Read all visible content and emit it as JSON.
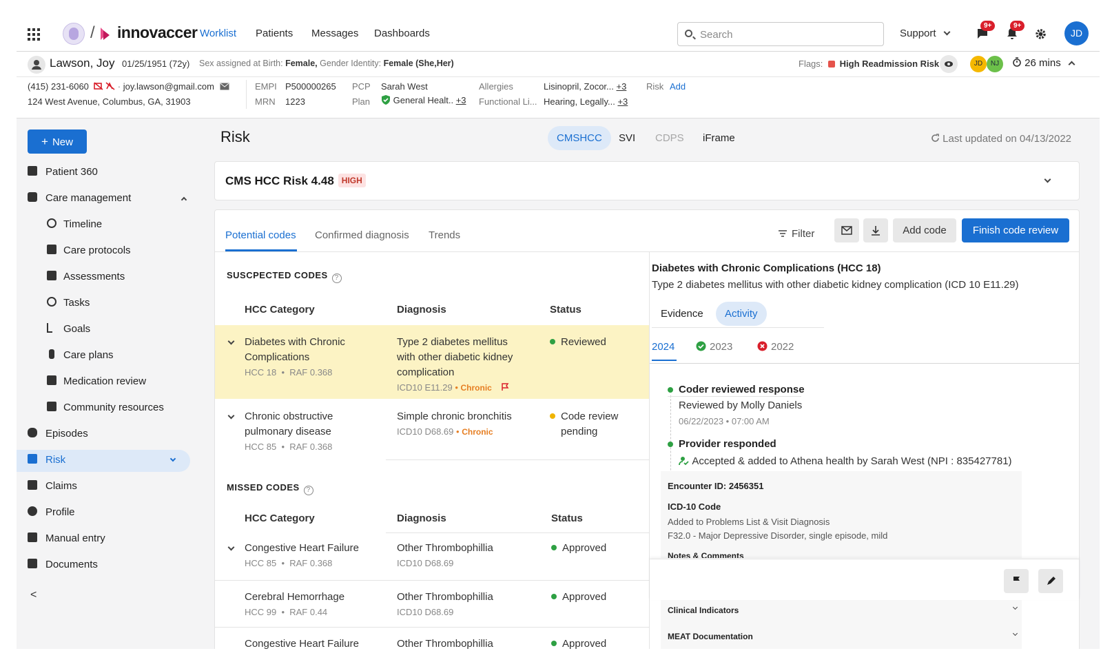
{
  "nav": {
    "brand": "innovaccer",
    "slash": "/",
    "links": [
      "Worklist",
      "Patients",
      "Messages",
      "Dashboards"
    ],
    "search_placeholder": "Search",
    "support": "Support",
    "chat_badge": "9+",
    "bell_badge": "9+",
    "avatar": "JD"
  },
  "patient": {
    "name": "Lawson, Joy",
    "dob": "01/25/1951 (72y)",
    "sex_label": "Sex assigned at Birth:",
    "sex_value": "Female,",
    "gender_label": "Gender Identity:",
    "gender_value": "Female (She,Her)",
    "flags_label": "Flags:",
    "flag_value": "High Readmission Risk",
    "team": [
      "JD",
      "NJ"
    ],
    "timer": "26 mins",
    "phone": "(415) 231-6060",
    "email": "joy.lawson@gmail.com",
    "address": "124 West Avenue, Columbus, GA, 31903",
    "empi_label": "EMPI",
    "empi": "P500000265",
    "mrn_label": "MRN",
    "mrn": "1223",
    "pcp_label": "PCP",
    "pcp": "Sarah West",
    "plan_label": "Plan",
    "plan": "General Healt..",
    "plan_more": "+3",
    "allergies_label": "Allergies",
    "allergies": "Lisinopril, Zocor...",
    "allergies_more": "+3",
    "functional_label": "Functional Li...",
    "functional": "Hearing, Legally...",
    "functional_more": "+3",
    "risk_label": "Risk",
    "risk_add": "Add"
  },
  "sidebar": {
    "new_label": "New",
    "items": [
      {
        "label": "Patient 360"
      },
      {
        "label": "Care management"
      },
      {
        "label": "Timeline"
      },
      {
        "label": "Care protocols"
      },
      {
        "label": "Assessments"
      },
      {
        "label": "Tasks"
      },
      {
        "label": "Goals"
      },
      {
        "label": "Care plans"
      },
      {
        "label": "Medication review"
      },
      {
        "label": "Community resources"
      },
      {
        "label": "Episodes"
      },
      {
        "label": "Risk"
      },
      {
        "label": "Claims"
      },
      {
        "label": "Profile"
      },
      {
        "label": "Manual entry"
      },
      {
        "label": "Documents"
      }
    ],
    "collapse": "<"
  },
  "main": {
    "title": "Risk",
    "pill_tabs": [
      "CMSHCC",
      "SVI",
      "CDPS",
      "iFrame"
    ],
    "last_updated": "Last updated on 04/13/2022",
    "score_title": "CMS HCC Risk 4.48",
    "score_badge": "HIGH",
    "tabs": [
      "Potential codes",
      "Confirmed diagnosis",
      "Trends"
    ],
    "filter": "Filter",
    "add_code": "Add code",
    "finish_review": "Finish code review"
  },
  "suspected": {
    "title": "SUSCPECTED CODES",
    "headers": [
      "HCC Category",
      "Diagnosis",
      "Status"
    ],
    "rows": [
      {
        "cat1": "Diabetes with Chronic",
        "cat2": "Complications",
        "hcc": "HCC 18",
        "raf": "RAF 0.368",
        "dx1": "Type 2 diabetes mellitus",
        "dx2": "with other diabetic kidney",
        "dx3": "complication",
        "icd": "ICD10 E11.29",
        "chronic": "Chronic",
        "status": "Reviewed"
      },
      {
        "cat1": "Chronic obstructive",
        "cat2": "pulmonary disease",
        "hcc": "HCC 85",
        "raf": "RAF 0.368",
        "dx1": "Simple chronic bronchitis",
        "icd": "ICD10 D68.69",
        "chronic": "Chronic",
        "status1": "Code review",
        "status2": "pending"
      }
    ]
  },
  "missed": {
    "title": "MISSED CODES",
    "headers": [
      "HCC Category",
      "Diagnosis",
      "Status"
    ],
    "rows": [
      {
        "cat": "Congestive Heart Failure",
        "hcc": "HCC 85",
        "raf": "RAF 0.368",
        "dx": "Other Thrombophillia",
        "icd": "ICD10 D68.69",
        "status": "Approved"
      },
      {
        "cat": "Cerebral Hemorrhage",
        "hcc": "HCC 99",
        "raf": "RAF 0.44",
        "dx": "Other Thrombophillia",
        "icd": "ICD10 D68.69",
        "status": "Approved"
      },
      {
        "cat": "Congestive Heart Failure",
        "dx": "Other Thrombophillia",
        "status": "Approved"
      }
    ]
  },
  "detail": {
    "title": "Diabetes with Chronic Complications (HCC 18)",
    "subtitle": "Type 2 diabetes mellitus with other diabetic kidney complication (ICD 10 E11.29)",
    "tabs": [
      "Evidence",
      "Activity"
    ],
    "years": [
      "2024",
      "2023",
      "2022"
    ],
    "events": [
      {
        "title": "Coder reviewed response",
        "line": "Reviewed by Molly Daniels",
        "time": "06/22/2023 • 07:00 AM"
      },
      {
        "title": "Provider responded",
        "line": "Accepted & added to Athena health by Sarah West (NPI : 835427781)"
      }
    ],
    "encounter": "Encounter ID: 2456351",
    "icd_title": "ICD-10 Code",
    "icd_line1": "Added to Problems List & Visit Diagnosis",
    "icd_line2": "F32.0 - Major Depressive Disorder, single episode, mild",
    "notes": "Notes & Comments",
    "clinical": "Clinical Indicators",
    "meat": "MEAT Documentation"
  },
  "colors": {
    "primary": "#1a6fd1",
    "highlight": "#fcf3c4",
    "success": "#2ea043",
    "warning": "#f0b400",
    "danger": "#d91f2b",
    "chronic": "#e67e22"
  }
}
